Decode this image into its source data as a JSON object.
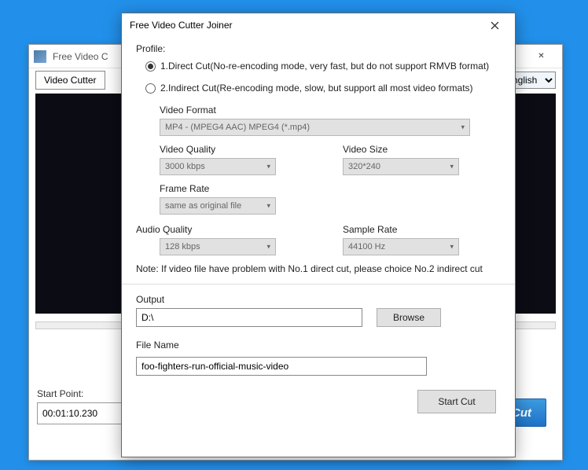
{
  "mainWindow": {
    "title": "Free Video C",
    "tab": "Video Cutter",
    "language": "English",
    "startPointLabel": "Start Point:",
    "startPointValue": "00:01:10.230",
    "cutLabel": "Cut"
  },
  "dialog": {
    "title": "Free Video Cutter Joiner",
    "profileLabel": "Profile:",
    "option1": "1.Direct Cut(No-re-encoding mode, very fast, but do not support RMVB format)",
    "option2": "2.Indirect Cut(Re-encoding mode, slow, but support all most video formats)",
    "videoFormatLabel": "Video Format",
    "videoFormatValue": "MP4 - (MPEG4 AAC) MPEG4 (*.mp4)",
    "videoQualityLabel": "Video Quality",
    "videoQualityValue": "3000 kbps",
    "videoSizeLabel": "Video Size",
    "videoSizeValue": "320*240",
    "frameRateLabel": "Frame Rate",
    "frameRateValue": "same as original file",
    "audioQualityLabel": "Audio Quality",
    "audioQualityValue": "128 kbps",
    "sampleRateLabel": "Sample Rate",
    "sampleRateValue": "44100 Hz",
    "note": "Note: If video file have problem with No.1 direct cut, please choice No.2 indirect cut",
    "outputLabel": "Output",
    "outputPath": "D:\\",
    "browseLabel": "Browse",
    "fileNameLabel": "File Name",
    "fileNameValue": "foo-fighters-run-official-music-video",
    "startCutLabel": "Start Cut"
  }
}
